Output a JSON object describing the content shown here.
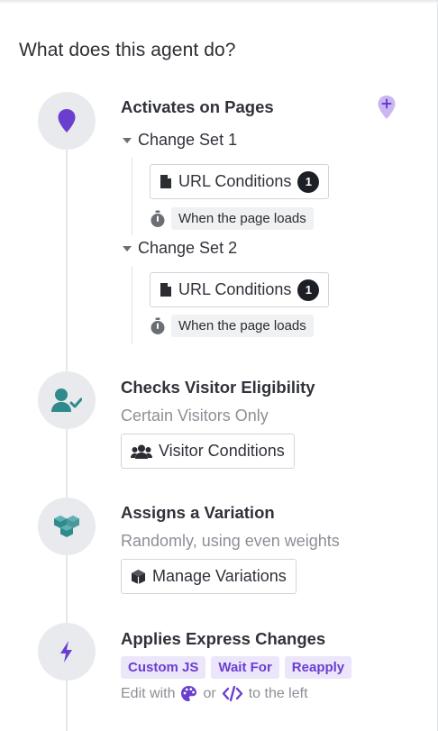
{
  "heading": "What does this agent do?",
  "steps": {
    "activates": {
      "title": "Activates on Pages",
      "icon": "map-pin-icon",
      "change_sets": [
        {
          "label": "Change Set 1",
          "url_button": "URL Conditions",
          "url_count": "1",
          "trigger": "When the page loads"
        },
        {
          "label": "Change Set 2",
          "url_button": "URL Conditions",
          "url_count": "1",
          "trigger": "When the page loads"
        }
      ]
    },
    "eligibility": {
      "title": "Checks Visitor Eligibility",
      "subtitle": "Certain Visitors Only",
      "button": "Visitor Conditions",
      "icon": "user-check-icon"
    },
    "variation": {
      "title": "Assigns a Variation",
      "subtitle": "Randomly, using even weights",
      "button": "Manage Variations",
      "icon": "boxes-icon"
    },
    "express": {
      "title": "Applies Express Changes",
      "tags": [
        "Custom JS",
        "Wait For",
        "Reapply"
      ],
      "edit_prefix": "Edit with",
      "edit_or": "or",
      "edit_suffix": "to the left",
      "icon": "lightning-icon"
    }
  },
  "colors": {
    "accent_purple": "#6a3fcf",
    "teal": "#2f8a8c",
    "tag_bg": "#ece6fb",
    "circle_bg": "#e9eaee"
  }
}
